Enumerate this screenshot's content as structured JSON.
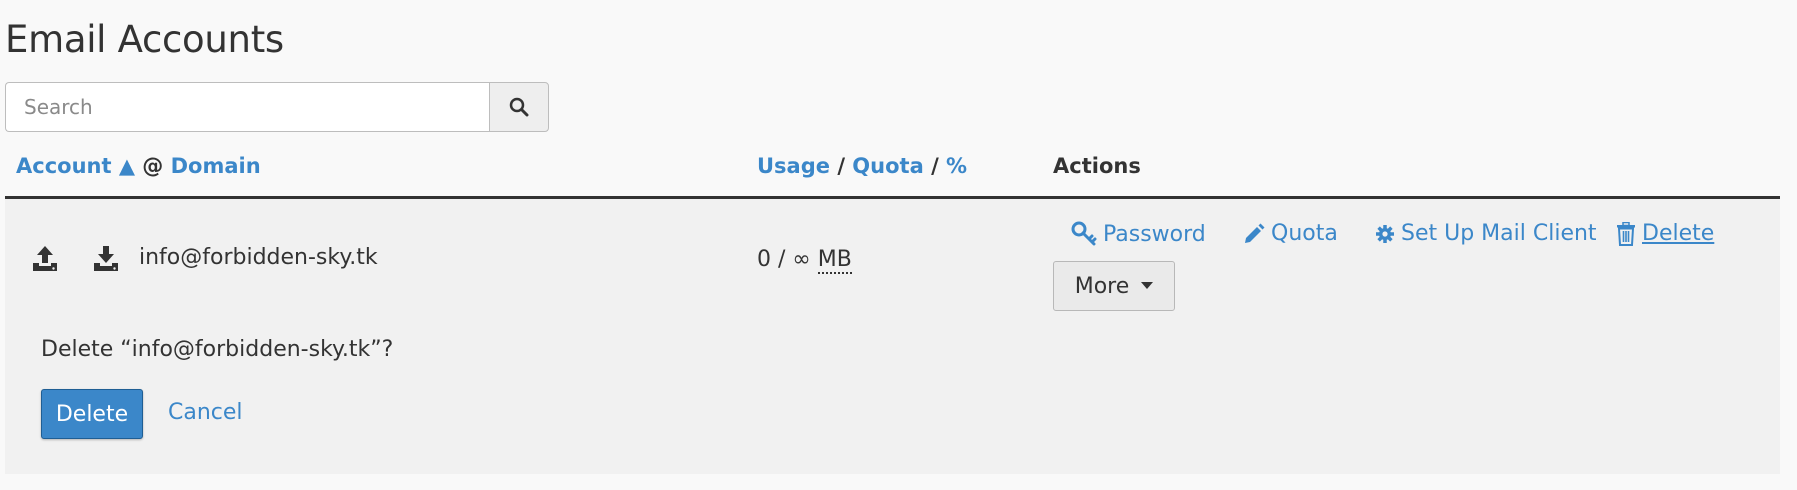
{
  "page": {
    "title": "Email Accounts"
  },
  "search": {
    "placeholder": "Search",
    "value": ""
  },
  "table": {
    "headers": {
      "account": "Account",
      "sort_indicator": "▲",
      "at_symbol": "@",
      "domain": "Domain",
      "usage": "Usage",
      "separator": "/",
      "quota": "Quota",
      "percent": "%",
      "actions": "Actions"
    },
    "rows": [
      {
        "email": "info@forbidden-sky.tk",
        "usage": "0",
        "separator": "/",
        "quota": "∞",
        "unit": "MB",
        "actions": {
          "password": "Password",
          "quota": "Quota",
          "setup_mail_client": "Set Up Mail Client",
          "delete": "Delete",
          "more": "More"
        },
        "confirm": {
          "message": "Delete “info@forbidden-sky.tk”?",
          "delete_label": "Delete",
          "cancel_label": "Cancel"
        }
      }
    ]
  },
  "colors": {
    "accent": "#3b87c9",
    "text": "#333333",
    "row_background": "#f1f1f1",
    "page_background": "#f9f9f9"
  },
  "icons": [
    "search-icon",
    "upload-icon",
    "download-icon",
    "key-icon",
    "pencil-icon",
    "gear-icon",
    "trash-icon",
    "caret-down-icon"
  ]
}
